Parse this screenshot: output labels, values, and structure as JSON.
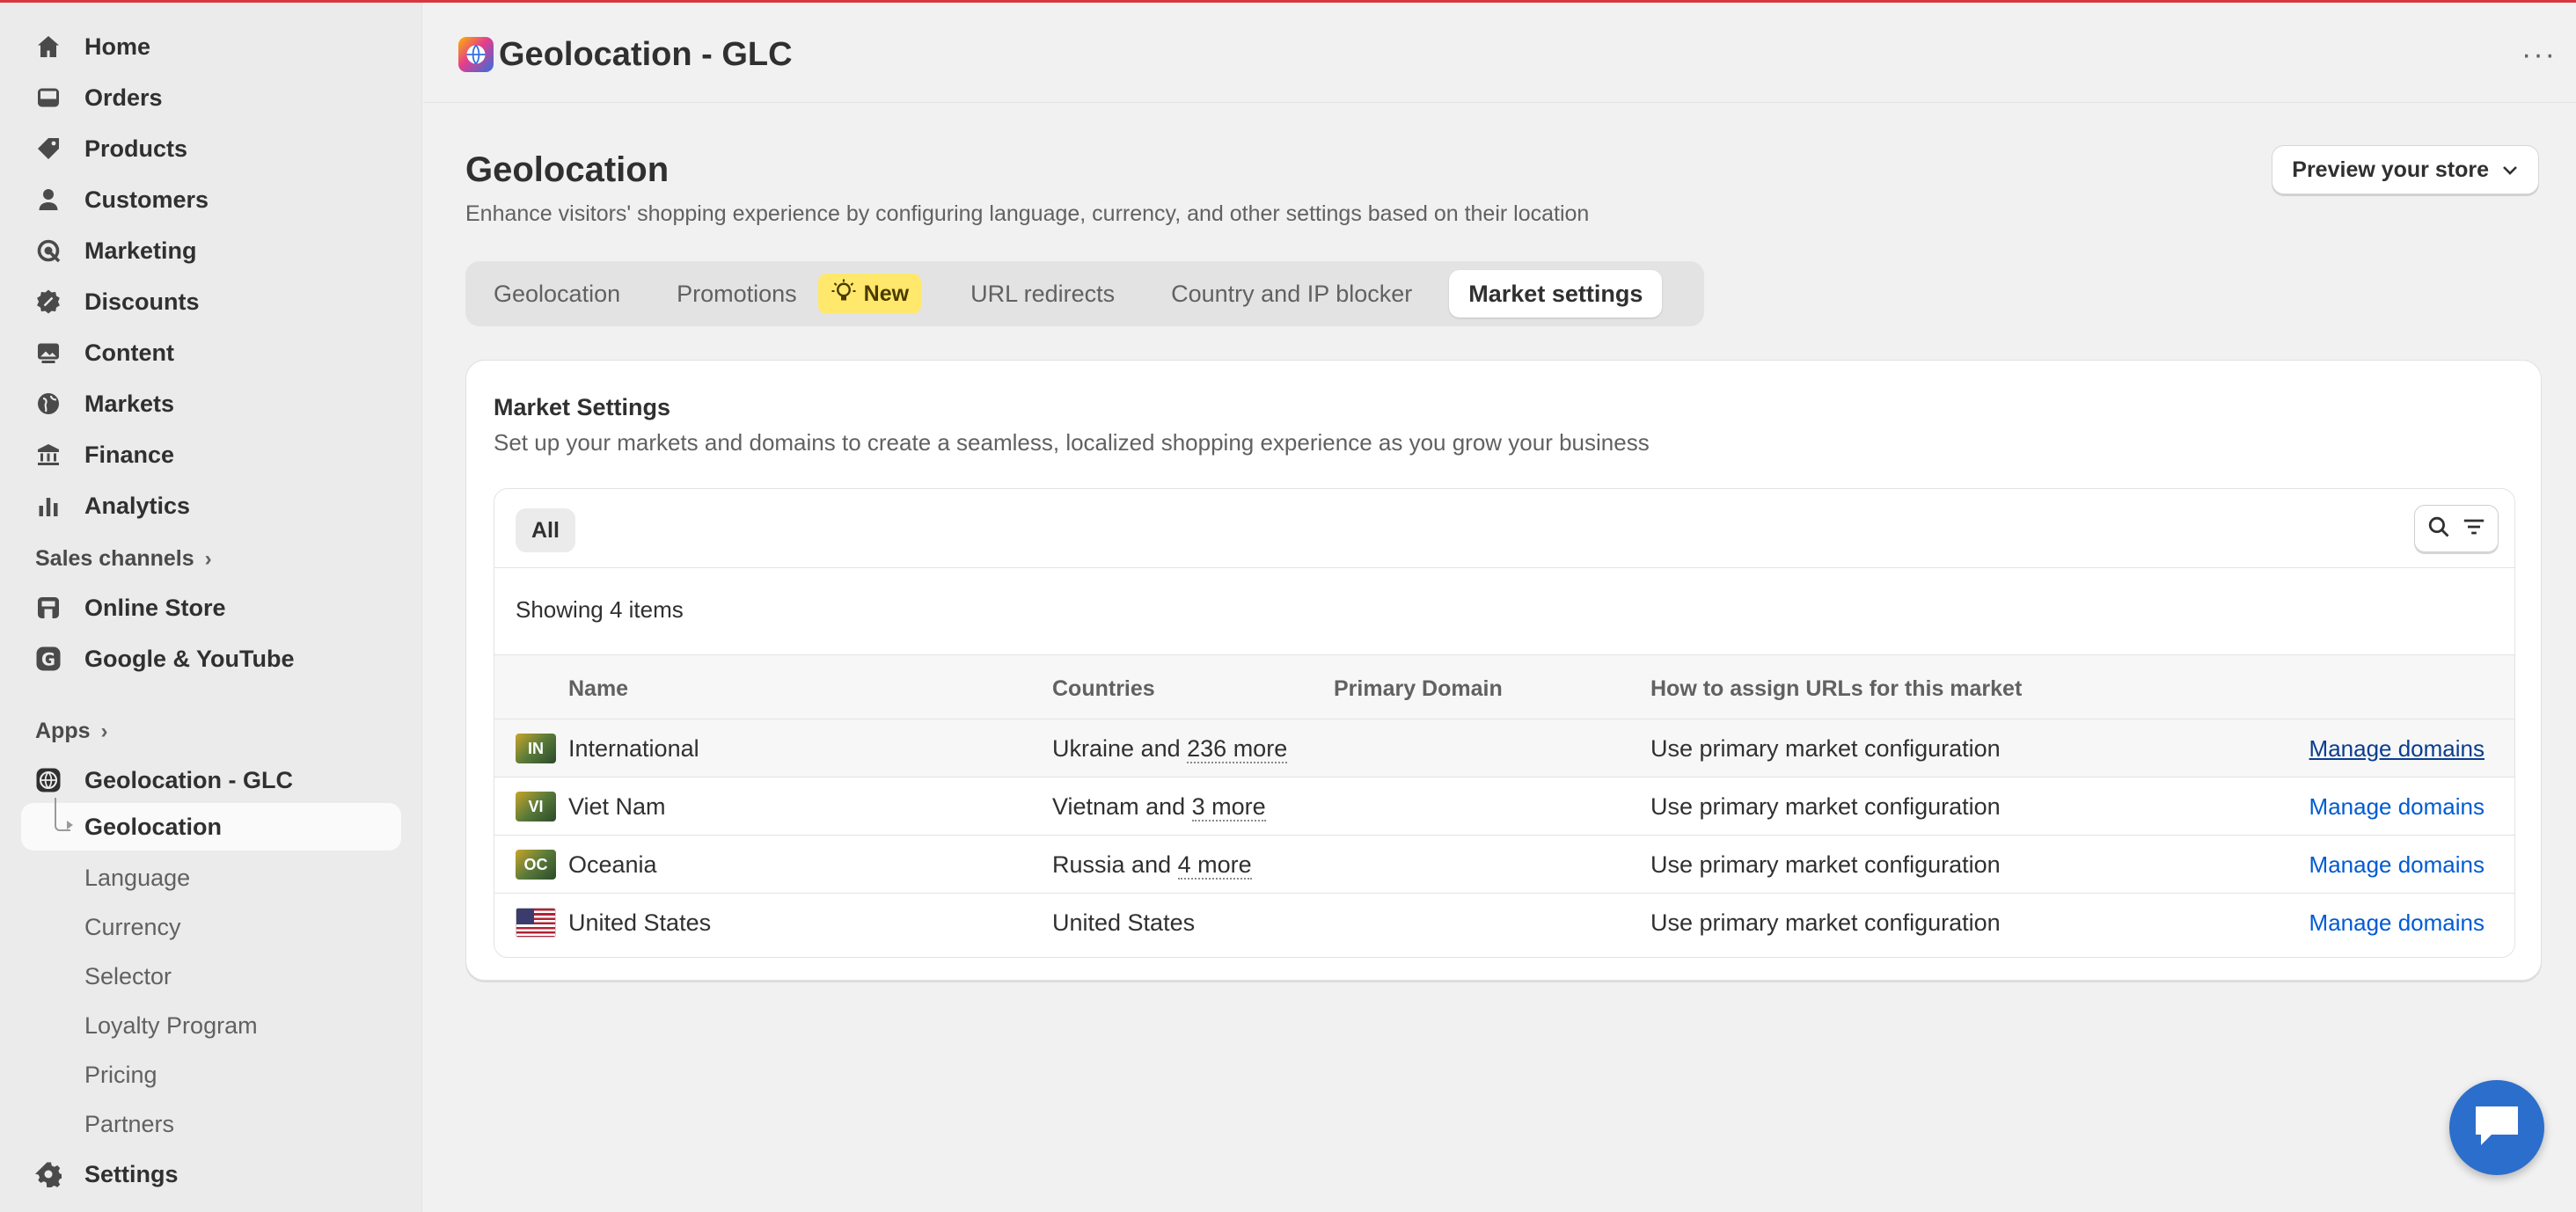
{
  "sidebar": {
    "nav": [
      {
        "label": "Home",
        "icon": "home-icon"
      },
      {
        "label": "Orders",
        "icon": "inbox-icon"
      },
      {
        "label": "Products",
        "icon": "tag-icon"
      },
      {
        "label": "Customers",
        "icon": "person-icon"
      },
      {
        "label": "Marketing",
        "icon": "target-icon"
      },
      {
        "label": "Discounts",
        "icon": "discount-icon"
      },
      {
        "label": "Content",
        "icon": "image-icon"
      },
      {
        "label": "Markets",
        "icon": "globe-icon"
      },
      {
        "label": "Finance",
        "icon": "bank-icon"
      },
      {
        "label": "Analytics",
        "icon": "bar-chart-icon"
      }
    ],
    "sales_channels_label": "Sales channels",
    "channels": [
      {
        "label": "Online Store",
        "icon": "store-icon"
      },
      {
        "label": "Google & YouTube",
        "icon": "google-icon"
      }
    ],
    "apps_label": "Apps",
    "app": {
      "label": "Geolocation - GLC",
      "icon": "globe-app-icon"
    },
    "app_subitems": [
      {
        "label": "Geolocation",
        "active": true
      },
      {
        "label": "Language"
      },
      {
        "label": "Currency"
      },
      {
        "label": "Selector"
      },
      {
        "label": "Loyalty Program"
      },
      {
        "label": "Pricing"
      },
      {
        "label": "Partners"
      }
    ],
    "settings_label": "Settings"
  },
  "header": {
    "app_title": "Geolocation - GLC",
    "more_label": "···"
  },
  "page": {
    "title": "Geolocation",
    "subtitle": "Enhance visitors' shopping experience by configuring language, currency, and other settings based on their location",
    "preview_button": "Preview your store"
  },
  "tabs": [
    {
      "label": "Geolocation"
    },
    {
      "label": "Promotions",
      "badge": "New"
    },
    {
      "label": "URL redirects"
    },
    {
      "label": "Country and IP blocker"
    },
    {
      "label": "Market settings",
      "active": true
    }
  ],
  "card": {
    "title": "Market Settings",
    "subtitle": "Set up your markets and domains to create a seamless, localized shopping experience as you grow your business",
    "filter_all": "All",
    "showing": "Showing 4 items",
    "columns": [
      "Name",
      "Countries",
      "Primary Domain",
      "How to assign URLs for this market"
    ],
    "rows": [
      {
        "code": "IN",
        "name": "International",
        "country": "Ukraine",
        "and": "and",
        "more": "236 more",
        "domain": "",
        "assign": "Use primary market configuration",
        "action": "Manage domains"
      },
      {
        "code": "VI",
        "name": "Viet Nam",
        "country": "Vietnam",
        "and": "and",
        "more": "3 more",
        "domain": "",
        "assign": "Use primary market configuration",
        "action": "Manage domains"
      },
      {
        "code": "OC",
        "name": "Oceania",
        "country": "Russia",
        "and": "and",
        "more": "4 more",
        "domain": "",
        "assign": "Use primary market configuration",
        "action": "Manage domains"
      },
      {
        "code": "US",
        "name": "United States",
        "country": "United States",
        "and": "",
        "more": "",
        "domain": "",
        "assign": "Use primary market configuration",
        "action": "Manage domains"
      }
    ]
  },
  "colors": {
    "accent": "#005bd3",
    "topline": "#d93641",
    "badge": "#ffe86b",
    "chat": "#2c6ecb"
  }
}
